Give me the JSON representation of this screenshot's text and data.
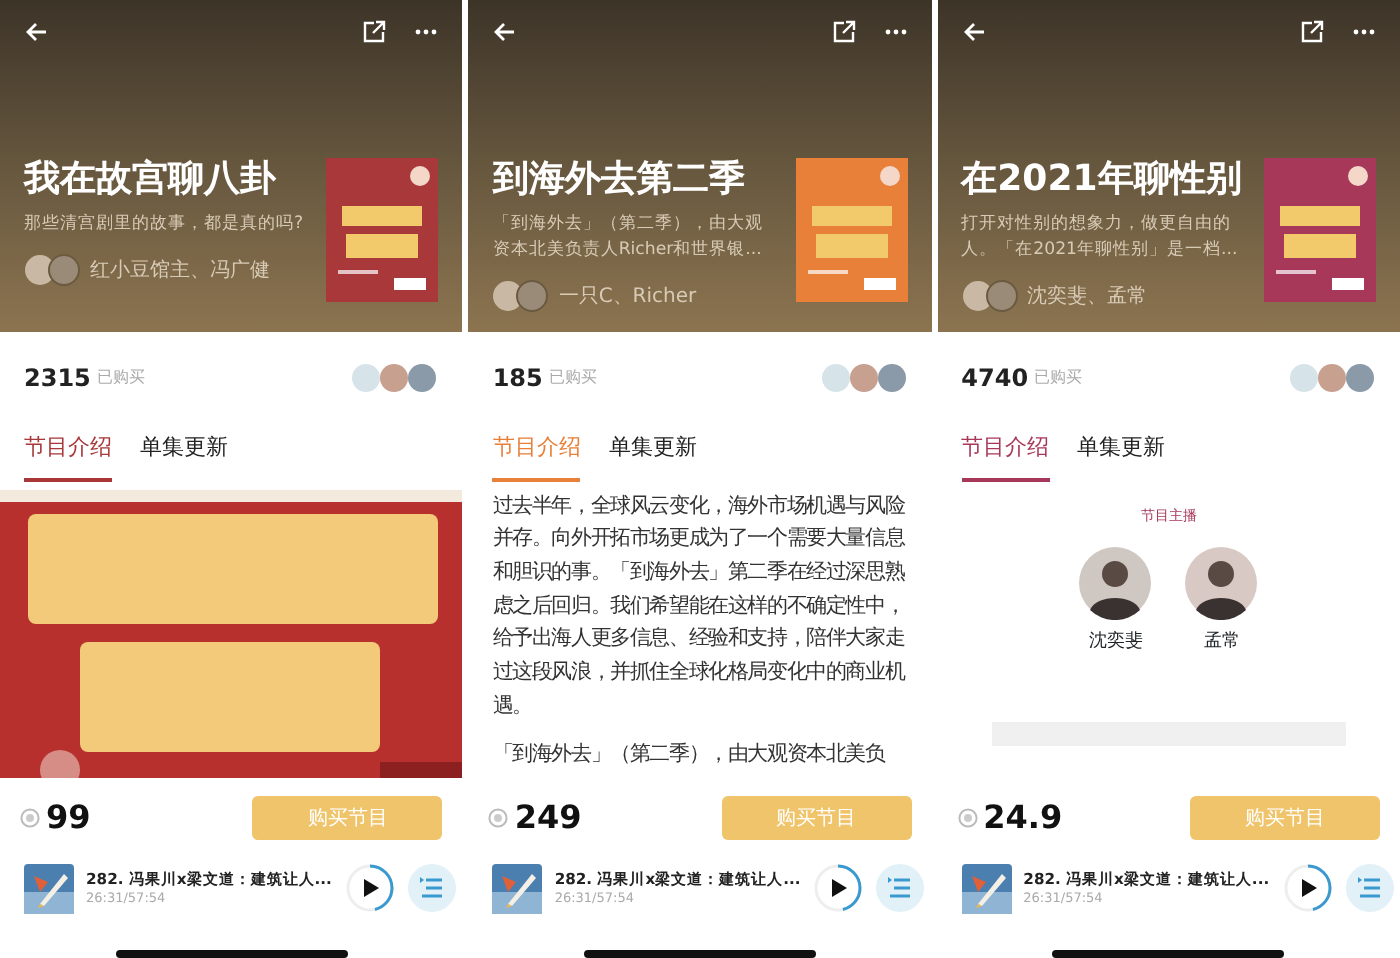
{
  "panels": [
    {
      "color": "#a8383a",
      "title": "我在故宫聊八卦",
      "description": "那些清宫剧里的故事，都是真的吗?",
      "authors": "红小豆馆主、冯广健",
      "buyers": "2315",
      "buyers_label": "已购买",
      "tabs": [
        {
          "label": "节目介绍",
          "selected": true
        },
        {
          "label": "单集更新",
          "selected": false
        }
      ],
      "content": {
        "kind": "banner"
      },
      "price": "99",
      "buy_button": "购买节目",
      "player": {
        "title": "282. 冯果川x梁文道：建筑让人...",
        "time": "26:31/57:54",
        "level": 0.46
      }
    },
    {
      "color": "#e8803a",
      "title": "到海外去第二季",
      "description": "「到海外去」（第二季），由大观资本北美负责人Richer和世界银...",
      "authors": "一只C、Richer",
      "buyers": "185",
      "buyers_label": "已购买",
      "tabs": [
        {
          "label": "节目介绍",
          "selected": true
        },
        {
          "label": "单集更新",
          "selected": false
        }
      ],
      "content": {
        "kind": "text",
        "paragraphs": [
          "过去半年，全球风云变化，海外市场机遇与风险并存。向外开拓市场更成为了一个需要大量信息和胆识的事。「到海外去」第二季在经过深思熟虑之后回归。我们希望能在这样的不确定性中，给予出海人更多信息、经验和支持，陪伴大家走过这段风浪，并抓住全球化格局变化中的商业机遇。",
          "「到海外去」（第二季），由大观资本北美负"
        ]
      },
      "price": "249",
      "buy_button": "购买节目",
      "player": {
        "title": "282. 冯果川x梁文道：建筑让人...",
        "time": "26:31/57:54",
        "level": 0.46
      }
    },
    {
      "color": "#a8385a",
      "title": "在2021年聊性别",
      "description": "打开对性别的想象力，做更自由的人。「在2021年聊性别」是一档...",
      "authors": "沈奕斐、孟常",
      "buyers": "4740",
      "buyers_label": "已购买",
      "tabs": [
        {
          "label": "节目介绍",
          "selected": true
        },
        {
          "label": "单集更新",
          "selected": false
        }
      ],
      "content": {
        "kind": "hosts",
        "heading": "节目主播",
        "hosts": [
          "沈奕斐",
          "孟常"
        ]
      },
      "price": "24.9",
      "buy_button": "购买节目",
      "player": {
        "title": "282. 冯果川x梁文道：建筑让人...",
        "time": "26:31/57:54",
        "level": 0.46
      }
    }
  ]
}
